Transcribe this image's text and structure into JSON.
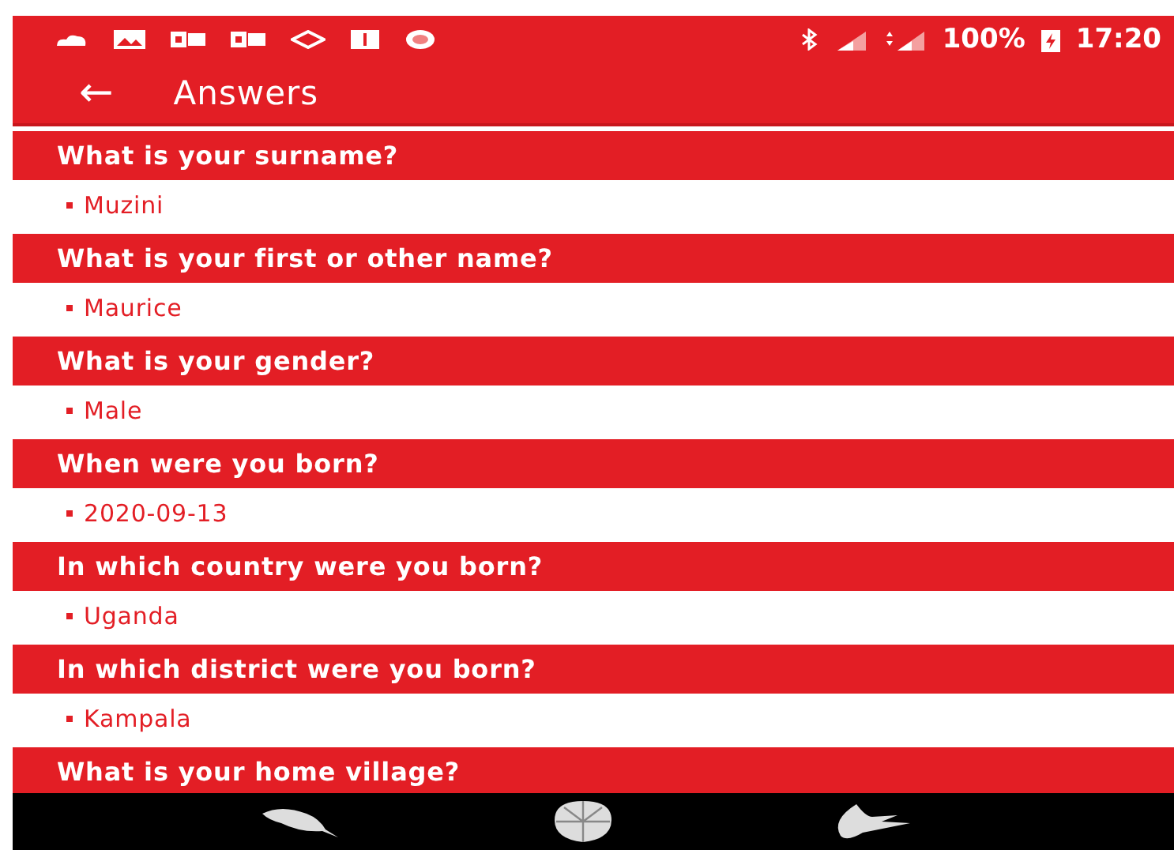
{
  "status_bar": {
    "battery": "100%",
    "time": "17:20"
  },
  "app_bar": {
    "back": "←",
    "title": "Answers"
  },
  "answers": [
    {
      "question": "What is your surname?",
      "answer": "Muzini"
    },
    {
      "question": "What is your first or other name?",
      "answer": "Maurice"
    },
    {
      "question": "What is your gender?",
      "answer": "Male"
    },
    {
      "question": "When were you born?",
      "answer": "2020-09-13"
    },
    {
      "question": "In which country were you born?",
      "answer": "Uganda"
    },
    {
      "question": "In which district were you born?",
      "answer": "Kampala"
    },
    {
      "question": "What is your home village?"
    }
  ]
}
